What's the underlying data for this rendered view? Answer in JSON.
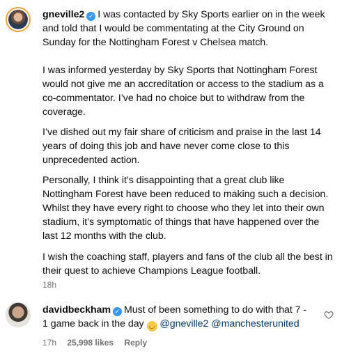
{
  "comments": [
    {
      "username": "gneville2",
      "paragraphs": [
        "I was contacted by Sky Sports earlier on in the week and told that I would be commentating at the City Ground on Sunday for the Nottingham Forest v Chelsea match.",
        "I was informed yesterday by Sky Sports that Nottingham Forest would not give me an accreditation or access to the stadium as a co-commentator. I’ve had no choice but to withdraw from the coverage.",
        "I’ve dished out my fair share of criticism and praise in the last 14 years of doing this job and have never come close to this unprecedented action.",
        "Personally, I think it’s disappointing that a great club like Nottingham Forest have been reduced to making such a decision. Whilst they have every right to choose who they let into their own stadium, it’s symptomatic of things that have happened over the last 12 months with the club.",
        "I wish the coaching staff, players and fans of the club all the best in their quest to achieve Champions League football."
      ],
      "time": "18h"
    },
    {
      "username": "davidbeckham",
      "text": "Must of been something to do with that 7 - 1 game back in the day",
      "emoji": "grinning-sweat-emoji",
      "mentions": [
        "@gneville2",
        "@manchesterunited"
      ],
      "time": "17h",
      "likes": "25,998 likes",
      "reply_label": "Reply"
    }
  ],
  "icons": {
    "verified": "verified-badge-icon",
    "heart": "heart-icon"
  },
  "colors": {
    "verified": "#3897f0",
    "mention": "#00376b",
    "meta": "#737373"
  }
}
